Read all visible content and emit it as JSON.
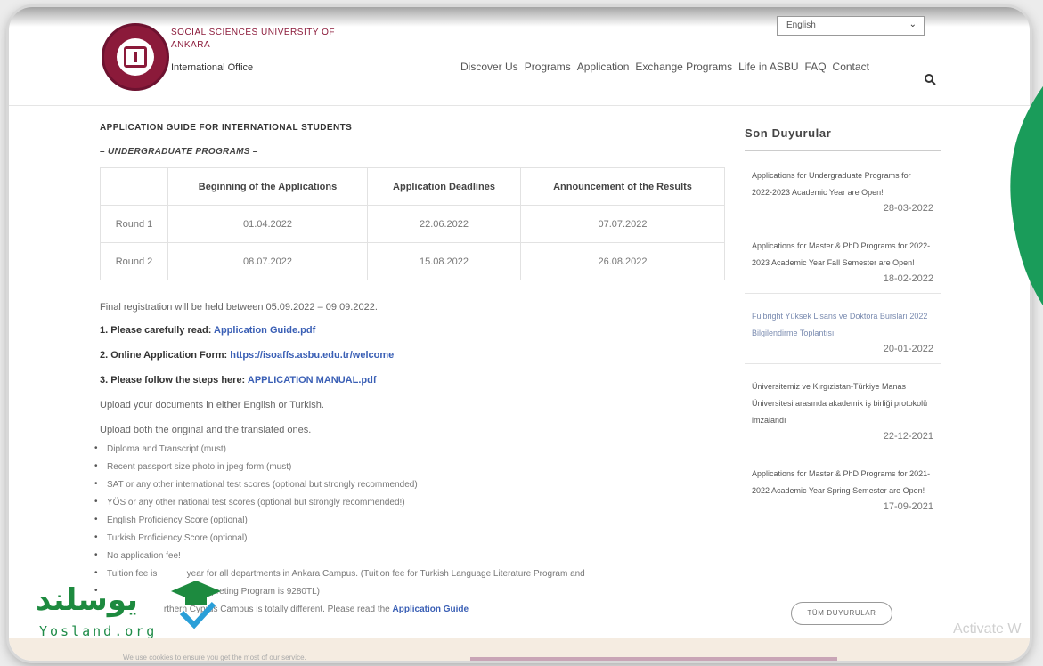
{
  "header": {
    "university_name": "SOCIAL SCIENCES UNIVERSITY OF ANKARA",
    "office": "International Office",
    "language_selected": "English",
    "nav": [
      "Discover Us",
      "Programs",
      "Application",
      "Exchange Programs",
      "Life in ASBU",
      "FAQ",
      "Contact"
    ]
  },
  "main": {
    "title": "APPLICATION GUIDE FOR INTERNATIONAL STUDENTS",
    "subtitle": "– UNDERGRADUATE PROGRAMS –",
    "table": {
      "headers": [
        "",
        "Beginning of the Applications",
        "Application Deadlines",
        "Announcement of the Results"
      ],
      "rows": [
        [
          "Round 1",
          "01.04.2022",
          "22.06.2022",
          "07.07.2022"
        ],
        [
          "Round 2",
          "08.07.2022",
          "15.08.2022",
          "26.08.2022"
        ]
      ]
    },
    "final_registration": "Final registration will be held between 05.09.2022 – 09.09.2022.",
    "step1_label": "1. Please carefully read:",
    "step1_link": "Application Guide.pdf",
    "step2_label": "2. Online Application Form:",
    "step2_link": "https://isoaffs.asbu.edu.tr/welcome",
    "step3_label": "3. Please follow the steps here:",
    "step3_link": "APPLICATION MANUAL.pdf",
    "upload_language": "Upload your documents in either English or Turkish.",
    "upload_both": "Upload both the original and the translated ones.",
    "bullets": [
      "Diploma and Transcript (must)",
      "Recent passport size photo in jpeg form (must)",
      "SAT or any other international test scores (optional but strongly recommended)",
      "YÖS or any other national test scores (optional but strongly recommended!)",
      "English Proficiency Score (optional)",
      "Turkish Proficiency Score (optional)",
      "No application fee!",
      "Tuition fee is            year for all departments in Ankara Campus. (Tuition fee for Turkish Language Literature Program and",
      "                                d Interpreting Program is 9280TL)",
      "                       rthern Cyprus Campus is totally different. Please read the"
    ],
    "application_guide_link": "Application Guide"
  },
  "sidebar": {
    "title": "Son Duyurular",
    "announcements": [
      {
        "title": "Applications for Undergraduate Programs for 2022-2023 Academic Year are Open!",
        "date": "28-03-2022"
      },
      {
        "title": "Applications for Master & PhD Programs for 2022-2023 Academic Year Fall Semester are Open!",
        "date": "18-02-2022"
      },
      {
        "title": "Fulbright Yüksek Lisans ve Doktora Bursları 2022 Bilgilendirme Toplantısı",
        "date": "20-01-2022"
      },
      {
        "title": "Üniversitemiz ve Kırgızistan-Türkiye Manas Üniversitesi arasında akademik iş birliği protokolü imzalandı",
        "date": "22-12-2021"
      },
      {
        "title": "Applications for Master & PhD Programs for 2021-2022 Academic Year Spring Semester are Open!",
        "date": "17-09-2021"
      }
    ],
    "all_button": "TÜM DUYURULAR"
  },
  "cookie": {
    "text": "We use cookies to ensure you get the most of our service."
  },
  "overlay": {
    "activate": "Activate W"
  },
  "watermark": {
    "arabic": "یوسلند",
    "latin": "Yosland.org"
  }
}
